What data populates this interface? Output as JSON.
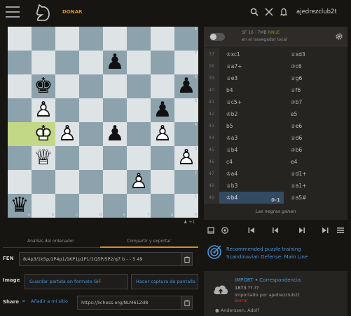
{
  "header": {
    "donate": "DONAR",
    "username": "ajedrezclub2t"
  },
  "board": {
    "files": [
      "a",
      "b",
      "c",
      "d",
      "e",
      "f",
      "g",
      "h"
    ],
    "ranks": [
      "8",
      "7",
      "6",
      "5",
      "4",
      "3",
      "2",
      "1"
    ],
    "colors": {
      "light": "#dee3e6",
      "dark": "#8ca2ad",
      "highlight": "#c3d887"
    },
    "fen": "8/4p3/1k5p/1P4p1/1KP1p1P1/1Q5P/5P2/q7 b - - 5 49",
    "highlighted_squares": [
      "a4",
      "b4"
    ],
    "pieces": [
      {
        "square": "e7",
        "color": "black",
        "type": "pawn"
      },
      {
        "square": "b6",
        "color": "black",
        "type": "king"
      },
      {
        "square": "h6",
        "color": "black",
        "type": "pawn"
      },
      {
        "square": "b5",
        "color": "white",
        "type": "pawn"
      },
      {
        "square": "g5",
        "color": "black",
        "type": "pawn"
      },
      {
        "square": "b4",
        "color": "white",
        "type": "king"
      },
      {
        "square": "c4",
        "color": "white",
        "type": "pawn"
      },
      {
        "square": "e4",
        "color": "black",
        "type": "pawn"
      },
      {
        "square": "g4",
        "color": "white",
        "type": "pawn"
      },
      {
        "square": "b3",
        "color": "white",
        "type": "queen"
      },
      {
        "square": "h3",
        "color": "white",
        "type": "pawn"
      },
      {
        "square": "f2",
        "color": "white",
        "type": "pawn"
      },
      {
        "square": "a1",
        "color": "black",
        "type": "queen"
      }
    ],
    "material_diff": "+1"
  },
  "engine": {
    "name": "SF 16 · 7MB",
    "nnue": "NNUE",
    "subtitle": "en el navegador local"
  },
  "moves": [
    {
      "num": "37",
      "white": "♔xc1",
      "black": "♕xd3"
    },
    {
      "num": "38",
      "white": "♕a7+",
      "black": "♔c6"
    },
    {
      "num": "39",
      "white": "♕e3",
      "black": "♕g6"
    },
    {
      "num": "40",
      "white": "b4",
      "black": "♕f6"
    },
    {
      "num": "41",
      "white": "♕c5+",
      "black": "♔b7"
    },
    {
      "num": "42",
      "white": "♔b2",
      "black": "e5"
    },
    {
      "num": "43",
      "white": "b5",
      "black": "♕e6"
    },
    {
      "num": "44",
      "white": "♔a3",
      "black": "♕d6"
    },
    {
      "num": "45",
      "white": "♕b4",
      "black": "♔b6"
    },
    {
      "num": "46",
      "white": "c4",
      "black": "e4"
    },
    {
      "num": "47",
      "white": "♔a4",
      "black": "♕d1+"
    },
    {
      "num": "48",
      "white": "♕b3",
      "black": "♕a1+"
    },
    {
      "num": "49",
      "white": "♔b4",
      "black": "♕a5#"
    }
  ],
  "current_move_index": 12,
  "result": {
    "score": "0-1",
    "text": "Las negras ganan"
  },
  "analysis_tabs": [
    "Análisis del ordenador",
    "Compartir y exportar"
  ],
  "fields": {
    "fen_label": "FEN",
    "fen_value": "8/4p3/1k5p/1P4p1/1KP1p1P1/1Q5P/5P2/q7 b - - 5 49",
    "image_label": "Image",
    "gif_button": "Guardar partida en formato GIF",
    "screenshot_button": "Hacer captura de pantalla",
    "share_label": "Share",
    "add_to_site": "Añadir a mi sitio",
    "share_url": "https://lichess.org/NLM61Zd8"
  },
  "puzzle": {
    "line1": "Recommended puzzle training",
    "line2": "Scandinavian Defense: Main Line"
  },
  "study": {
    "import": "IMPORT",
    "correspondence": "Correspondencia",
    "date": "1873.??.??",
    "imported_by": "Importado por ajedrezclub2t",
    "delete": "Borrar",
    "player": "Anderssen, Adolf"
  }
}
